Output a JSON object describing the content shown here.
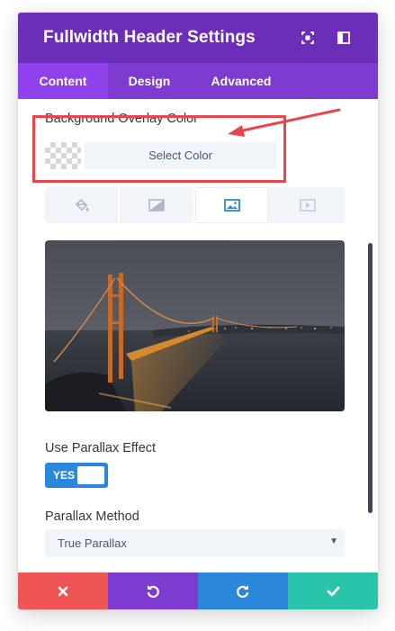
{
  "header": {
    "title": "Fullwidth Header Settings",
    "icons": [
      "expand-icon",
      "sidebar-layout-icon"
    ],
    "color": "#6c2eb9"
  },
  "tabs": [
    {
      "label": "Content",
      "active": true
    },
    {
      "label": "Design",
      "active": false
    },
    {
      "label": "Advanced",
      "active": false
    }
  ],
  "background_overlay": {
    "label": "Background Overlay Color",
    "button_label": "Select Color"
  },
  "background_tabs": [
    {
      "icon": "paint-bucket-icon",
      "active": false
    },
    {
      "icon": "gradient-icon",
      "active": false
    },
    {
      "icon": "image-icon",
      "active": true
    },
    {
      "icon": "video-icon",
      "active": false
    }
  ],
  "image_preview": {
    "subject": "golden-gate-bridge-night-photo"
  },
  "parallax": {
    "label": "Use Parallax Effect",
    "toggle_label": "YES",
    "enabled": true
  },
  "parallax_method": {
    "label": "Parallax Method",
    "selected": "True Parallax"
  },
  "footer": {
    "buttons": [
      {
        "icon": "close-icon",
        "color": "#ef5555"
      },
      {
        "icon": "undo-icon",
        "color": "#7e3bd0"
      },
      {
        "icon": "redo-icon",
        "color": "#2b87da"
      },
      {
        "icon": "check-icon",
        "color": "#29c4a9"
      }
    ]
  },
  "annotation": {
    "color": "#e8454c"
  }
}
